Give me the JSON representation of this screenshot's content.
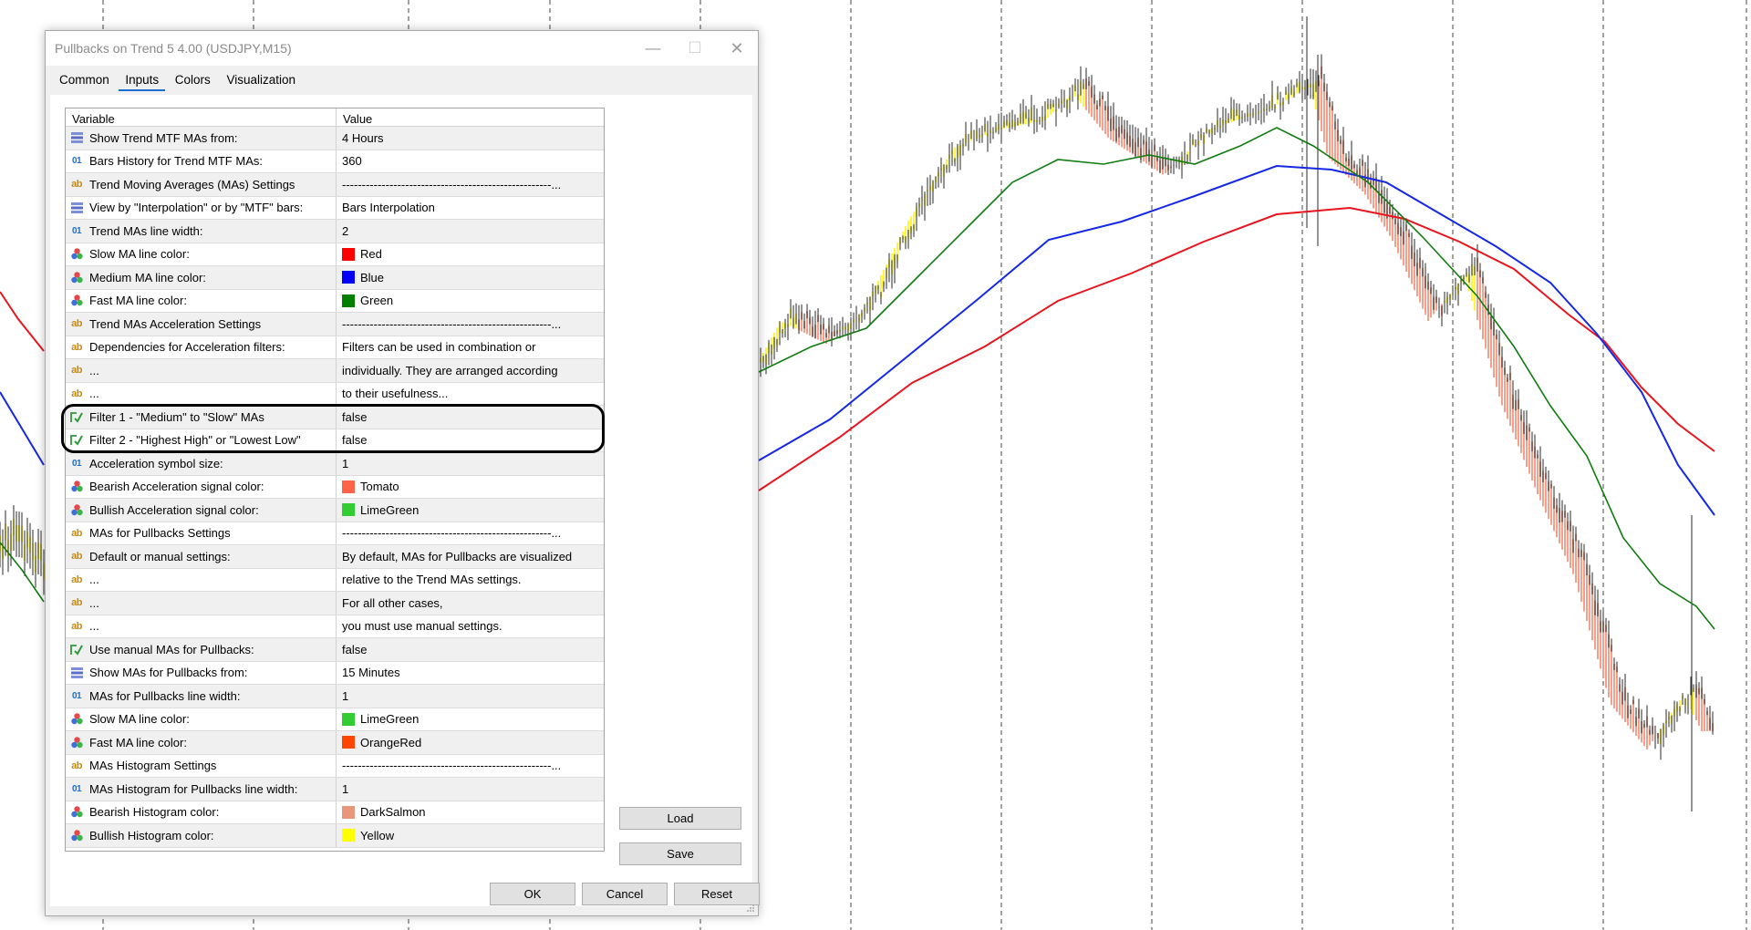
{
  "dialog": {
    "title": "Pullbacks on Trend 5 4.00 (USDJPY,M15)",
    "tabs": [
      {
        "label": "Common",
        "active": false
      },
      {
        "label": "Inputs",
        "active": true
      },
      {
        "label": "Colors",
        "active": false
      },
      {
        "label": "Visualization",
        "active": false
      }
    ],
    "columns": {
      "variable": "Variable",
      "value": "Value"
    },
    "rows": [
      {
        "icon": "list-icon",
        "name": "Show Trend MTF MAs from:",
        "value": "4 Hours"
      },
      {
        "icon": "int-icon",
        "name": "Bars History for Trend MTF MAs:",
        "value": "360"
      },
      {
        "icon": "string-icon",
        "name": "Trend Moving Averages (MAs) Settings",
        "value": "-----------------------------------------------------..."
      },
      {
        "icon": "list-icon",
        "name": "View by \"Interpolation\" or by \"MTF\" bars:",
        "value": "Bars Interpolation"
      },
      {
        "icon": "int-icon",
        "name": "Trend MAs line width:",
        "value": "2"
      },
      {
        "icon": "color-icon",
        "name": "Slow MA line color:",
        "value": "Red",
        "swatch": "#ff0000"
      },
      {
        "icon": "color-icon",
        "name": "Medium MA line color:",
        "value": "Blue",
        "swatch": "#0000ff"
      },
      {
        "icon": "color-icon",
        "name": "Fast MA line color:",
        "value": "Green",
        "swatch": "#008000"
      },
      {
        "icon": "string-icon",
        "name": "Trend MAs Acceleration Settings",
        "value": "-----------------------------------------------------..."
      },
      {
        "icon": "string-icon",
        "name": "Dependencies for Acceleration filters:",
        "value": "Filters can be used in combination or"
      },
      {
        "icon": "string-icon",
        "name": "...",
        "value": "individually. They are arranged according"
      },
      {
        "icon": "string-icon",
        "name": "...",
        "value": "to their usefulness..."
      },
      {
        "icon": "bool-icon",
        "name": "Filter 1 - \"Medium\" to \"Slow\" MAs",
        "value": "false"
      },
      {
        "icon": "bool-icon",
        "name": "Filter 2 - \"Highest High\" or \"Lowest Low\"",
        "value": "false"
      },
      {
        "icon": "int-icon",
        "name": "Acceleration symbol size:",
        "value": "1"
      },
      {
        "icon": "color-icon",
        "name": "Bearish Acceleration signal color:",
        "value": "Tomato",
        "swatch": "#ff6347"
      },
      {
        "icon": "color-icon",
        "name": "Bullish Acceleration signal color:",
        "value": "LimeGreen",
        "swatch": "#32cd32"
      },
      {
        "icon": "string-icon",
        "name": "MAs for Pullbacks Settings",
        "value": "-----------------------------------------------------..."
      },
      {
        "icon": "string-icon",
        "name": "Default or manual settings:",
        "value": "By default, MAs for Pullbacks are visualized"
      },
      {
        "icon": "string-icon",
        "name": "...",
        "value": "relative to the Trend MAs settings."
      },
      {
        "icon": "string-icon",
        "name": "...",
        "value": "For all other cases,"
      },
      {
        "icon": "string-icon",
        "name": "...",
        "value": "you must use manual settings."
      },
      {
        "icon": "bool-icon",
        "name": "Use manual MAs for Pullbacks:",
        "value": "false"
      },
      {
        "icon": "list-icon",
        "name": "Show MAs for Pullbacks from:",
        "value": "15 Minutes"
      },
      {
        "icon": "int-icon",
        "name": "MAs for Pullbacks line width:",
        "value": "1"
      },
      {
        "icon": "color-icon",
        "name": "Slow MA line color:",
        "value": "LimeGreen",
        "swatch": "#32cd32"
      },
      {
        "icon": "color-icon",
        "name": "Fast MA line color:",
        "value": "OrangeRed",
        "swatch": "#ff4500"
      },
      {
        "icon": "string-icon",
        "name": "MAs Histogram Settings",
        "value": "-----------------------------------------------------..."
      },
      {
        "icon": "int-icon",
        "name": "MAs Histogram for Pullbacks line width:",
        "value": "1"
      },
      {
        "icon": "color-icon",
        "name": "Bearish Histogram color:",
        "value": "DarkSalmon",
        "swatch": "#e9967a"
      },
      {
        "icon": "color-icon",
        "name": "Bullish Histogram color:",
        "value": "Yellow",
        "swatch": "#ffff00"
      }
    ],
    "buttons": {
      "load": "Load",
      "save": "Save",
      "ok": "OK",
      "cancel": "Cancel",
      "reset": "Reset"
    }
  },
  "colors": {
    "slow_ma": "#e8141e",
    "medium_ma": "#1428e6",
    "fast_ma": "#107c10",
    "bull_hist": "#fff53c",
    "bear_hist": "#f4a08c",
    "candles": "#2a2a2a",
    "ok_blue": "#1a6fd1"
  }
}
